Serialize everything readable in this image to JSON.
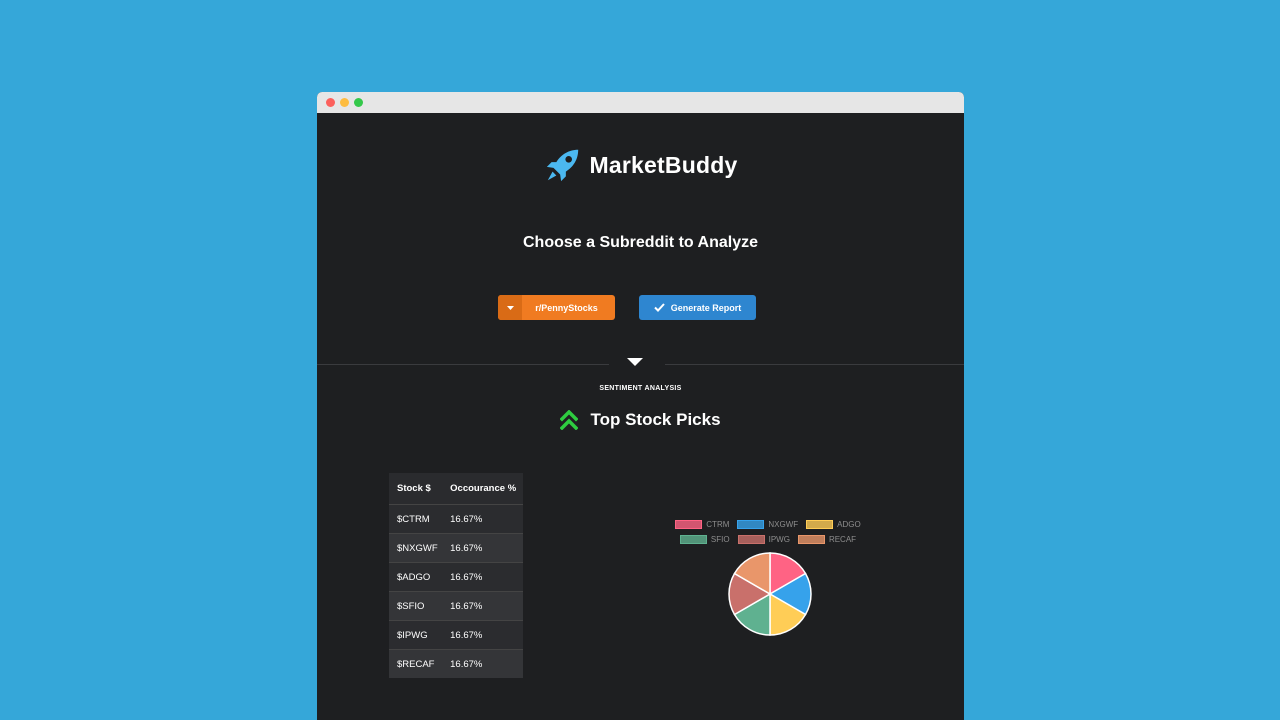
{
  "app": {
    "name": "MarketBuddy"
  },
  "heading": "Choose a Subreddit to Analyze",
  "subreddit_button": {
    "label": "r/PennyStocks"
  },
  "generate_button": {
    "label": "Generate Report"
  },
  "section_label": "SENTIMENT ANALYSIS",
  "section_title": "Top Stock Picks",
  "table": {
    "headers": [
      "Stock $",
      "Occourance %"
    ],
    "rows": [
      [
        "$CTRM",
        "16.67%"
      ],
      [
        "$NXGWF",
        "16.67%"
      ],
      [
        "$ADGO",
        "16.67%"
      ],
      [
        "$SFIO",
        "16.67%"
      ],
      [
        "$IPWG",
        "16.67%"
      ],
      [
        "$RECAF",
        "16.67%"
      ]
    ]
  },
  "chart_data": {
    "type": "pie",
    "categories": [
      "CTRM",
      "NXGWF",
      "ADGO",
      "SFIO",
      "IPWG",
      "RECAF"
    ],
    "values": [
      16.67,
      16.67,
      16.67,
      16.67,
      16.67,
      16.67
    ],
    "colors": [
      "#ff6384",
      "#36a2eb",
      "#ffcd56",
      "#5fb190",
      "#c9706b",
      "#e9966a"
    ],
    "legend": "top"
  },
  "colors": {
    "accent_orange": "#f07b21",
    "accent_blue": "#2e86d0",
    "logo_blue": "#4bb8f0",
    "picks_green": "#2ecc40"
  }
}
